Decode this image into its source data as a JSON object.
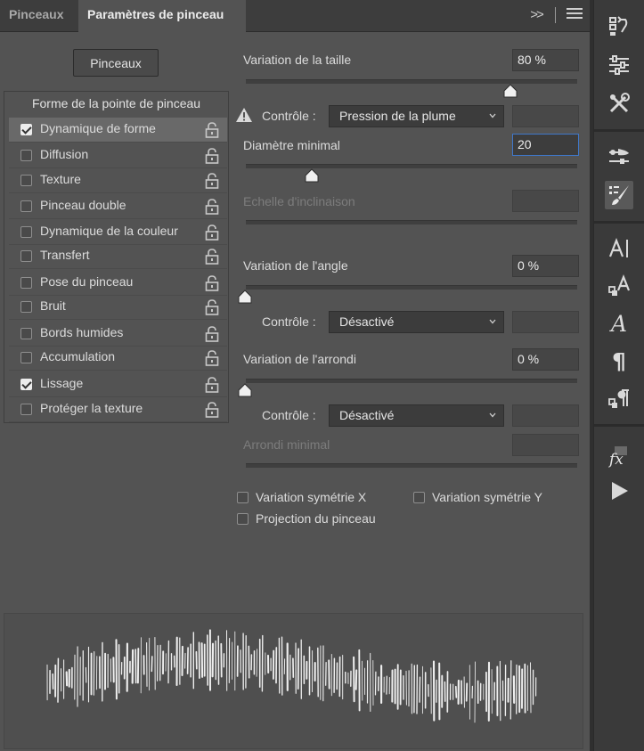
{
  "tabs": [
    {
      "label": "Pinceaux",
      "active": false
    },
    {
      "label": "Paramètres de pinceau",
      "active": true
    }
  ],
  "expand_label": ">>",
  "brushes_button": "Pinceaux",
  "options_header": "Forme de la pointe de pinceau",
  "options": [
    {
      "label": "Dynamique de forme",
      "checked": true,
      "selected": true
    },
    {
      "label": "Diffusion",
      "checked": false
    },
    {
      "label": "Texture",
      "checked": false
    },
    {
      "label": "Pinceau double",
      "checked": false
    },
    {
      "label": "Dynamique de la couleur",
      "checked": false
    },
    {
      "label": "Transfert",
      "checked": false
    },
    {
      "label": "Pose du pinceau",
      "checked": false
    },
    {
      "label": "Bruit",
      "checked": false
    },
    {
      "label": "Bords humides",
      "checked": false
    },
    {
      "label": "Accumulation",
      "checked": false
    },
    {
      "label": "Lissage",
      "checked": true
    },
    {
      "label": "Protéger la texture",
      "checked": false
    }
  ],
  "size_jitter": {
    "label": "Variation de la taille",
    "value": "80 %",
    "level": 0.8
  },
  "size_control": {
    "label": "Contrôle :",
    "value": "Pression de la plume",
    "warning_icon": "warning-icon"
  },
  "min_diameter": {
    "label": "Diamètre minimal",
    "value": "20",
    "level": 0.2
  },
  "tilt_scale": {
    "label": "Echelle d'inclinaison",
    "value": ""
  },
  "angle_jitter": {
    "label": "Variation de l'angle",
    "value": "0 %",
    "level": 0
  },
  "angle_control": {
    "label": "Contrôle :",
    "value": "Désactivé"
  },
  "roundness_jitter": {
    "label": "Variation de l'arrondi",
    "value": "0 %",
    "level": 0
  },
  "roundness_control": {
    "label": "Contrôle :",
    "value": "Désactivé"
  },
  "min_roundness": {
    "label": "Arrondi minimal",
    "value": ""
  },
  "flip_x": {
    "label": "Variation symétrie X",
    "checked": false
  },
  "flip_y": {
    "label": "Variation symétrie Y",
    "checked": false
  },
  "brush_projection": {
    "label": "Projection du pinceau",
    "checked": false
  },
  "toolbar_icons": [
    "history-icon",
    "adjustments-icon",
    "tools-icon",
    "brush-presets-icon",
    "brush-settings-icon",
    "character-icon",
    "character-styles-icon",
    "glyphs-icon",
    "paragraph-icon",
    "paragraph-styles-icon",
    "fx-icon",
    "play-icon"
  ],
  "colors": {
    "panel_bg": "#535353",
    "tab_bg": "#3d3d3d",
    "toolbar_bg": "#3a3a3a",
    "focus_border": "#3f77c8"
  }
}
